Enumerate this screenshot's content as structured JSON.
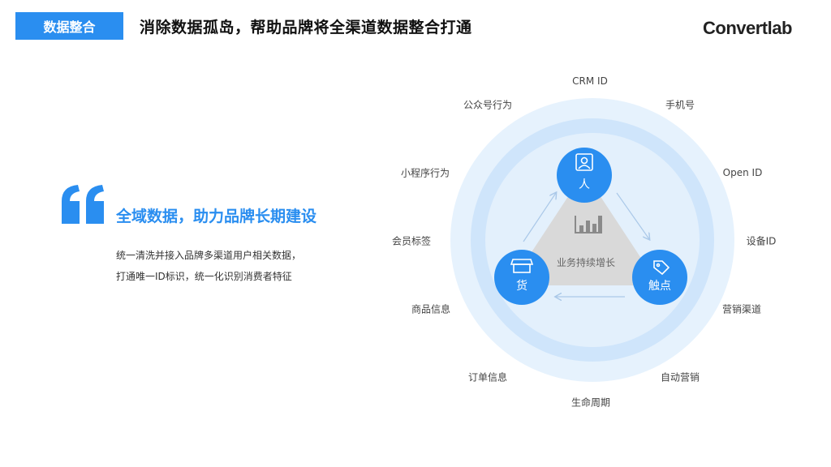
{
  "header": {
    "badge": "数据整合",
    "title": "消除数据孤岛，帮助品牌将全渠道数据整合打通",
    "logo": "Convertlab"
  },
  "left": {
    "slogan": "全域数据，助力品牌长期建设",
    "desc_lines": [
      "统一清洗并接入品牌多渠道用户相关数据，",
      "打通唯一ID标识，统一化识别消费者特征"
    ]
  },
  "diagram": {
    "center_label": "业务持续增长",
    "nodes": {
      "person": "人",
      "goods": "货",
      "touch": "触点"
    },
    "outer_labels": {
      "crm_id": "CRM ID",
      "phone": "手机号",
      "open_id": "Open ID",
      "device_id": "设备ID",
      "marketing_channel": "营销渠道",
      "auto_marketing": "自动营销",
      "lifecycle": "生命周期",
      "order_info": "订单信息",
      "product_info": "商品信息",
      "member_tags": "会员标签",
      "miniprogram_behavior": "小程序行为",
      "official_account_behavior": "公众号行为"
    },
    "colors": {
      "accent": "#2a8ef0",
      "ring_outer": "#e6f2fd",
      "ring_mid": "#cfe5fb",
      "ring_inner": "#e3f0fc",
      "triangle": "#d9d9d9"
    },
    "icons": [
      "person-card-icon",
      "bar-chart-icon",
      "shop-icon",
      "tag-icon"
    ]
  }
}
